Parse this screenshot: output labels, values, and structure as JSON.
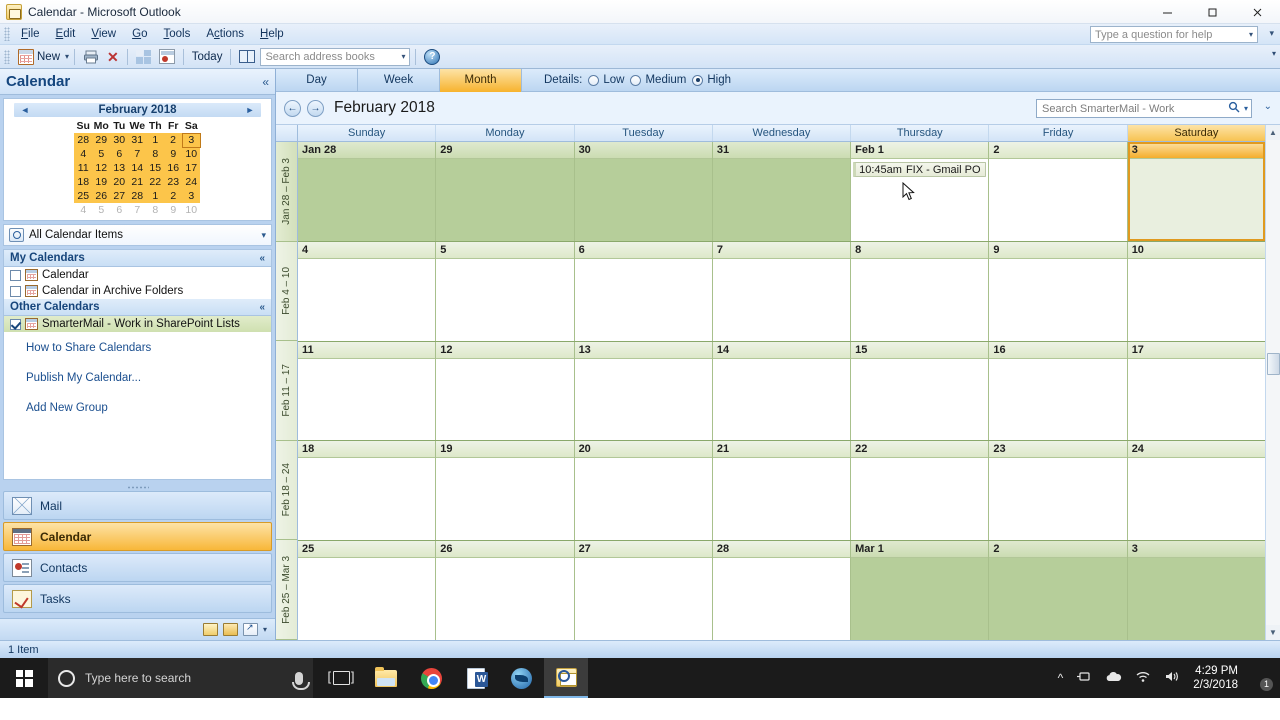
{
  "window": {
    "title": "Calendar - Microsoft Outlook",
    "minimize": "–",
    "maximize": "❐",
    "close": "✕"
  },
  "menu": {
    "items": [
      "File",
      "Edit",
      "View",
      "Go",
      "Tools",
      "Actions",
      "Help"
    ],
    "help_placeholder": "Type a question for help",
    "dropdown_caret": "▾"
  },
  "toolbar": {
    "new_label": "New",
    "today_label": "Today",
    "search_books_placeholder": "Search address books",
    "help_glyph": "?",
    "close_glyph": "✕",
    "overflow_caret": "▾"
  },
  "navpane": {
    "title": "Calendar",
    "collapse_glyph": "«",
    "minical": {
      "month_label": "February 2018",
      "prev_glyph": "◄",
      "next_glyph": "►",
      "weekday_headers": [
        "Su",
        "Mo",
        "Tu",
        "We",
        "Th",
        "Fr",
        "Sa"
      ],
      "weeks": [
        [
          {
            "d": "28",
            "s": "in"
          },
          {
            "d": "29",
            "s": "in"
          },
          {
            "d": "30",
            "s": "in"
          },
          {
            "d": "31",
            "s": "in"
          },
          {
            "d": "1",
            "s": "in"
          },
          {
            "d": "2",
            "s": "in"
          },
          {
            "d": "3",
            "s": "today"
          }
        ],
        [
          {
            "d": "4",
            "s": "in"
          },
          {
            "d": "5",
            "s": "in"
          },
          {
            "d": "6",
            "s": "in"
          },
          {
            "d": "7",
            "s": "in"
          },
          {
            "d": "8",
            "s": "in"
          },
          {
            "d": "9",
            "s": "in"
          },
          {
            "d": "10",
            "s": "in"
          }
        ],
        [
          {
            "d": "11",
            "s": "in"
          },
          {
            "d": "12",
            "s": "in"
          },
          {
            "d": "13",
            "s": "in"
          },
          {
            "d": "14",
            "s": "in"
          },
          {
            "d": "15",
            "s": "in"
          },
          {
            "d": "16",
            "s": "in"
          },
          {
            "d": "17",
            "s": "in"
          }
        ],
        [
          {
            "d": "18",
            "s": "in"
          },
          {
            "d": "19",
            "s": "in"
          },
          {
            "d": "20",
            "s": "in"
          },
          {
            "d": "21",
            "s": "in"
          },
          {
            "d": "22",
            "s": "in"
          },
          {
            "d": "23",
            "s": "in"
          },
          {
            "d": "24",
            "s": "in"
          }
        ],
        [
          {
            "d": "25",
            "s": "in"
          },
          {
            "d": "26",
            "s": "in"
          },
          {
            "d": "27",
            "s": "in"
          },
          {
            "d": "28",
            "s": "in"
          },
          {
            "d": "1",
            "s": "in"
          },
          {
            "d": "2",
            "s": "in"
          },
          {
            "d": "3",
            "s": "in"
          }
        ],
        [
          {
            "d": "4",
            "s": "dim"
          },
          {
            "d": "5",
            "s": "dim"
          },
          {
            "d": "6",
            "s": "dim"
          },
          {
            "d": "7",
            "s": "dim"
          },
          {
            "d": "8",
            "s": "dim"
          },
          {
            "d": "9",
            "s": "dim"
          },
          {
            "d": "10",
            "s": "dim"
          }
        ]
      ]
    },
    "all_items_label": "All Calendar Items",
    "all_items_caret": "▾",
    "groups": [
      {
        "header": "My Calendars",
        "collapse_glyph": "«",
        "items": [
          {
            "label": "Calendar",
            "checked": false,
            "selected": false
          },
          {
            "label": "Calendar in Archive Folders",
            "checked": false,
            "selected": false
          }
        ]
      },
      {
        "header": "Other Calendars",
        "collapse_glyph": "«",
        "items": [
          {
            "label": "SmarterMail - Work in SharePoint Lists",
            "checked": true,
            "selected": true
          }
        ]
      }
    ],
    "links": [
      "How to Share Calendars",
      "Publish My Calendar...",
      "Add New Group"
    ],
    "buttons": [
      {
        "label": "Mail",
        "icon": "mail-icon",
        "active": false
      },
      {
        "label": "Calendar",
        "icon": "calendar-icon",
        "active": true
      },
      {
        "label": "Contacts",
        "icon": "contacts-icon",
        "active": false
      },
      {
        "label": "Tasks",
        "icon": "tasks-icon",
        "active": false
      }
    ],
    "footer_caret": "▾"
  },
  "viewbar": {
    "tabs": [
      {
        "label": "Day",
        "active": false
      },
      {
        "label": "Week",
        "active": false
      },
      {
        "label": "Month",
        "active": true
      }
    ],
    "details_label": "Details:",
    "details_options": [
      {
        "label": "Low",
        "selected": false
      },
      {
        "label": "Medium",
        "selected": false
      },
      {
        "label": "High",
        "selected": true
      }
    ]
  },
  "calendar": {
    "prev_glyph": "←",
    "next_glyph": "→",
    "title": "February 2018",
    "search_placeholder": "Search SmarterMail - Work",
    "search_icon": "magnifier-icon",
    "search_caret": "▾",
    "expand_glyph": "⌄",
    "day_headers": [
      {
        "label": "Sunday",
        "selected": false
      },
      {
        "label": "Monday",
        "selected": false
      },
      {
        "label": "Tuesday",
        "selected": false
      },
      {
        "label": "Wednesday",
        "selected": false
      },
      {
        "label": "Thursday",
        "selected": false
      },
      {
        "label": "Friday",
        "selected": false
      },
      {
        "label": "Saturday",
        "selected": true
      }
    ],
    "weeks": [
      {
        "label": "Jan 28 – Feb 3",
        "days": [
          {
            "num": "Jan 28",
            "other": true,
            "today": false,
            "appts": []
          },
          {
            "num": "29",
            "other": true,
            "today": false,
            "appts": []
          },
          {
            "num": "30",
            "other": true,
            "today": false,
            "appts": []
          },
          {
            "num": "31",
            "other": true,
            "today": false,
            "appts": []
          },
          {
            "num": "Feb 1",
            "other": false,
            "today": false,
            "appts": [
              {
                "time": "10:45am",
                "subject": "FIX - Gmail PO"
              }
            ]
          },
          {
            "num": "2",
            "other": false,
            "today": false,
            "appts": []
          },
          {
            "num": "3",
            "other": false,
            "today": true,
            "appts": []
          }
        ]
      },
      {
        "label": "Feb 4 – 10",
        "days": [
          {
            "num": "4",
            "other": false,
            "today": false,
            "appts": []
          },
          {
            "num": "5",
            "other": false,
            "today": false,
            "appts": []
          },
          {
            "num": "6",
            "other": false,
            "today": false,
            "appts": []
          },
          {
            "num": "7",
            "other": false,
            "today": false,
            "appts": []
          },
          {
            "num": "8",
            "other": false,
            "today": false,
            "appts": []
          },
          {
            "num": "9",
            "other": false,
            "today": false,
            "appts": []
          },
          {
            "num": "10",
            "other": false,
            "today": false,
            "appts": []
          }
        ]
      },
      {
        "label": "Feb 11 – 17",
        "days": [
          {
            "num": "11",
            "other": false,
            "today": false,
            "appts": []
          },
          {
            "num": "12",
            "other": false,
            "today": false,
            "appts": []
          },
          {
            "num": "13",
            "other": false,
            "today": false,
            "appts": []
          },
          {
            "num": "14",
            "other": false,
            "today": false,
            "appts": []
          },
          {
            "num": "15",
            "other": false,
            "today": false,
            "appts": []
          },
          {
            "num": "16",
            "other": false,
            "today": false,
            "appts": []
          },
          {
            "num": "17",
            "other": false,
            "today": false,
            "appts": []
          }
        ]
      },
      {
        "label": "Feb 18 – 24",
        "days": [
          {
            "num": "18",
            "other": false,
            "today": false,
            "appts": []
          },
          {
            "num": "19",
            "other": false,
            "today": false,
            "appts": []
          },
          {
            "num": "20",
            "other": false,
            "today": false,
            "appts": []
          },
          {
            "num": "21",
            "other": false,
            "today": false,
            "appts": []
          },
          {
            "num": "22",
            "other": false,
            "today": false,
            "appts": []
          },
          {
            "num": "23",
            "other": false,
            "today": false,
            "appts": []
          },
          {
            "num": "24",
            "other": false,
            "today": false,
            "appts": []
          }
        ]
      },
      {
        "label": "Feb 25 – Mar 3",
        "days": [
          {
            "num": "25",
            "other": false,
            "today": false,
            "appts": []
          },
          {
            "num": "26",
            "other": false,
            "today": false,
            "appts": []
          },
          {
            "num": "27",
            "other": false,
            "today": false,
            "appts": []
          },
          {
            "num": "28",
            "other": false,
            "today": false,
            "appts": []
          },
          {
            "num": "Mar 1",
            "other": true,
            "today": false,
            "appts": []
          },
          {
            "num": "2",
            "other": true,
            "today": false,
            "appts": []
          },
          {
            "num": "3",
            "other": true,
            "today": false,
            "appts": []
          }
        ]
      }
    ],
    "scroll_up_glyph": "▲",
    "scroll_down_glyph": "▼"
  },
  "statusbar": {
    "text": "1 Item"
  },
  "taskbar": {
    "search_placeholder": "Type here to search",
    "apps": [
      {
        "name": "task-view-icon",
        "active": false
      },
      {
        "name": "file-explorer-icon",
        "active": false
      },
      {
        "name": "chrome-icon",
        "active": false
      },
      {
        "name": "word-icon",
        "active": false
      },
      {
        "name": "thunderbird-icon",
        "active": false
      },
      {
        "name": "outlook-icon",
        "active": true
      }
    ],
    "tray": [
      "^",
      "network-icon",
      "onedrive-icon",
      "wifi-icon",
      "volume-icon"
    ],
    "time": "4:29 PM",
    "date": "2/3/2018",
    "notification_count": "1"
  },
  "colors": {
    "accent_orange": "#f7b32e",
    "chrome_blue": "#bcd6f1",
    "calendar_green": "#b6ce9a",
    "today_border": "#e09a1f"
  }
}
